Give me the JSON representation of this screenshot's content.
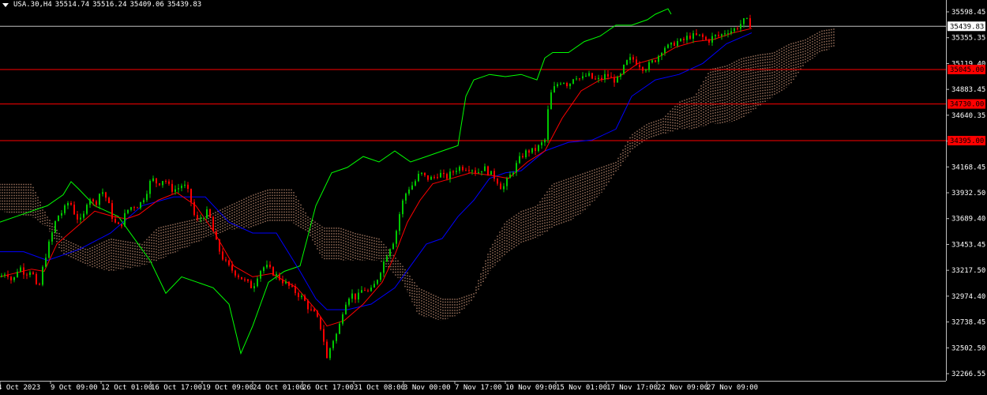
{
  "header": {
    "symbol": "USA.30,H4",
    "open": "35514.74",
    "high": "35516.24",
    "low": "35409.06",
    "close": "35439.83"
  },
  "chart_data": {
    "type": "candlestick",
    "background": "#000000",
    "colors": {
      "bull": "#00c800",
      "bear": "#ff0000",
      "tenkan": "#ff0000",
      "kijun": "#0000ff",
      "chikou": "#00ff00",
      "cloud": "#ffbd9a",
      "hline": "#ff0000",
      "current_price_line": "#c0c0c0",
      "axis": "#c0c0c0"
    },
    "ylim": [
      32200,
      35680
    ],
    "y_ticks": [
      "35598.45",
      "35355.35",
      "35119.40",
      "34883.45",
      "34640.35",
      "34404.40",
      "34168.45",
      "33932.50",
      "33689.40",
      "33453.45",
      "33217.50",
      "32974.40",
      "32738.45",
      "32502.50",
      "32266.55"
    ],
    "x_ticks": [
      "4 Oct 2023",
      "9 Oct 09:00",
      "12 Oct 01:00",
      "16 Oct 17:00",
      "19 Oct 09:00",
      "24 Oct 01:00",
      "26 Oct 17:00",
      "31 Oct 08:00",
      "3 Nov 00:00",
      "7 Nov 17:00",
      "10 Nov 09:00",
      "15 Nov 01:00",
      "17 Nov 17:00",
      "22 Nov 09:00",
      "27 Nov 09:00"
    ],
    "horizontal_levels": [
      {
        "label": "35045.00",
        "value": 35045.0
      },
      {
        "label": "34730.00",
        "value": 34730.0
      },
      {
        "label": "34395.00",
        "value": 34395.0
      }
    ],
    "current_price": {
      "label": "35439.83",
      "value": 35439.83
    },
    "close_path": [
      [
        0,
        33150
      ],
      [
        8,
        33200
      ],
      [
        16,
        33100
      ],
      [
        24,
        33250
      ],
      [
        32,
        33180
      ],
      [
        40,
        33220
      ],
      [
        48,
        33000
      ],
      [
        56,
        33300
      ],
      [
        64,
        33500
      ],
      [
        72,
        33700
      ],
      [
        80,
        33750
      ],
      [
        88,
        33850
      ],
      [
        96,
        33700
      ],
      [
        104,
        33650
      ],
      [
        112,
        33900
      ],
      [
        120,
        33800
      ],
      [
        128,
        33950
      ],
      [
        136,
        33850
      ],
      [
        144,
        33650
      ],
      [
        152,
        33600
      ],
      [
        160,
        33750
      ],
      [
        168,
        33800
      ],
      [
        176,
        33800
      ],
      [
        184,
        33900
      ],
      [
        192,
        34050
      ],
      [
        200,
        34000
      ],
      [
        208,
        34050
      ],
      [
        216,
        33950
      ],
      [
        224,
        33950
      ],
      [
        232,
        34000
      ],
      [
        240,
        33900
      ],
      [
        248,
        33650
      ],
      [
        256,
        33700
      ],
      [
        264,
        33750
      ],
      [
        272,
        33500
      ],
      [
        280,
        33350
      ],
      [
        288,
        33250
      ],
      [
        296,
        33200
      ],
      [
        304,
        33150
      ],
      [
        312,
        33100
      ],
      [
        320,
        33050
      ],
      [
        328,
        33200
      ],
      [
        336,
        33250
      ],
      [
        344,
        33200
      ],
      [
        352,
        33150
      ],
      [
        360,
        33100
      ],
      [
        368,
        33050
      ],
      [
        376,
        33000
      ],
      [
        384,
        32950
      ],
      [
        392,
        32850
      ],
      [
        400,
        32800
      ],
      [
        408,
        32650
      ],
      [
        414,
        32400
      ],
      [
        420,
        32550
      ],
      [
        428,
        32650
      ],
      [
        436,
        32900
      ],
      [
        444,
        33000
      ],
      [
        452,
        32950
      ],
      [
        460,
        33050
      ],
      [
        468,
        33000
      ],
      [
        476,
        33100
      ],
      [
        484,
        33250
      ],
      [
        492,
        33400
      ],
      [
        500,
        33500
      ],
      [
        508,
        33800
      ],
      [
        516,
        33950
      ],
      [
        524,
        34000
      ],
      [
        532,
        34100
      ],
      [
        540,
        34050
      ],
      [
        548,
        34050
      ],
      [
        556,
        34100
      ],
      [
        564,
        34050
      ],
      [
        572,
        34100
      ],
      [
        580,
        34150
      ],
      [
        588,
        34150
      ],
      [
        596,
        34150
      ],
      [
        604,
        34100
      ],
      [
        612,
        34150
      ],
      [
        620,
        34100
      ],
      [
        628,
        34050
      ],
      [
        636,
        33950
      ],
      [
        644,
        34050
      ],
      [
        652,
        34150
      ],
      [
        660,
        34250
      ],
      [
        668,
        34300
      ],
      [
        676,
        34300
      ],
      [
        684,
        34350
      ],
      [
        690,
        34400
      ],
      [
        696,
        34800
      ],
      [
        704,
        34900
      ],
      [
        712,
        34950
      ],
      [
        720,
        34900
      ],
      [
        728,
        35000
      ],
      [
        736,
        34950
      ],
      [
        744,
        35000
      ],
      [
        752,
        34950
      ],
      [
        760,
        34950
      ],
      [
        768,
        35000
      ],
      [
        776,
        34950
      ],
      [
        784,
        34950
      ],
      [
        792,
        35100
      ],
      [
        800,
        35150
      ],
      [
        808,
        35100
      ],
      [
        816,
        35050
      ],
      [
        824,
        35100
      ],
      [
        832,
        35150
      ],
      [
        840,
        35250
      ],
      [
        848,
        35250
      ],
      [
        856,
        35300
      ],
      [
        864,
        35300
      ],
      [
        872,
        35350
      ],
      [
        880,
        35350
      ],
      [
        888,
        35350
      ],
      [
        896,
        35300
      ],
      [
        904,
        35350
      ],
      [
        912,
        35350
      ],
      [
        920,
        35400
      ],
      [
        928,
        35400
      ],
      [
        936,
        35450
      ],
      [
        944,
        35500
      ],
      [
        952,
        35440
      ]
    ],
    "tenkan_path": [
      [
        0,
        33150
      ],
      [
        40,
        33220
      ],
      [
        56,
        33200
      ],
      [
        72,
        33450
      ],
      [
        96,
        33600
      ],
      [
        120,
        33750
      ],
      [
        144,
        33700
      ],
      [
        160,
        33680
      ],
      [
        176,
        33720
      ],
      [
        200,
        33850
      ],
      [
        224,
        33920
      ],
      [
        248,
        33800
      ],
      [
        272,
        33550
      ],
      [
        296,
        33250
      ],
      [
        320,
        33150
      ],
      [
        344,
        33180
      ],
      [
        376,
        33050
      ],
      [
        400,
        32850
      ],
      [
        414,
        32700
      ],
      [
        436,
        32750
      ],
      [
        460,
        32900
      ],
      [
        484,
        33100
      ],
      [
        500,
        33350
      ],
      [
        516,
        33650
      ],
      [
        532,
        33850
      ],
      [
        548,
        34000
      ],
      [
        572,
        34050
      ],
      [
        596,
        34100
      ],
      [
        620,
        34080
      ],
      [
        644,
        34050
      ],
      [
        668,
        34200
      ],
      [
        690,
        34300
      ],
      [
        712,
        34600
      ],
      [
        736,
        34850
      ],
      [
        760,
        34950
      ],
      [
        784,
        34980
      ],
      [
        808,
        35100
      ],
      [
        832,
        35150
      ],
      [
        856,
        35250
      ],
      [
        880,
        35300
      ],
      [
        904,
        35320
      ],
      [
        928,
        35380
      ],
      [
        952,
        35420
      ]
    ],
    "kijun_path": [
      [
        0,
        33380
      ],
      [
        30,
        33380
      ],
      [
        60,
        33300
      ],
      [
        100,
        33400
      ],
      [
        140,
        33550
      ],
      [
        180,
        33800
      ],
      [
        220,
        33880
      ],
      [
        260,
        33880
      ],
      [
        290,
        33650
      ],
      [
        320,
        33550
      ],
      [
        350,
        33550
      ],
      [
        380,
        33200
      ],
      [
        400,
        32950
      ],
      [
        414,
        32850
      ],
      [
        440,
        32850
      ],
      [
        470,
        32900
      ],
      [
        500,
        33050
      ],
      [
        520,
        33250
      ],
      [
        540,
        33450
      ],
      [
        560,
        33500
      ],
      [
        580,
        33700
      ],
      [
        600,
        33850
      ],
      [
        620,
        34050
      ],
      [
        640,
        34100
      ],
      [
        660,
        34120
      ],
      [
        690,
        34300
      ],
      [
        720,
        34380
      ],
      [
        750,
        34400
      ],
      [
        780,
        34500
      ],
      [
        800,
        34800
      ],
      [
        830,
        34950
      ],
      [
        860,
        35000
      ],
      [
        890,
        35100
      ],
      [
        920,
        35280
      ],
      [
        952,
        35380
      ]
    ],
    "chikou_path": [
      [
        0,
        33650
      ],
      [
        20,
        33700
      ],
      [
        40,
        33750
      ],
      [
        60,
        33800
      ],
      [
        80,
        33900
      ],
      [
        90,
        34020
      ],
      [
        100,
        33950
      ],
      [
        120,
        33800
      ],
      [
        150,
        33700
      ],
      [
        170,
        33500
      ],
      [
        190,
        33300
      ],
      [
        210,
        33000
      ],
      [
        230,
        33150
      ],
      [
        250,
        33100
      ],
      [
        270,
        33050
      ],
      [
        290,
        32900
      ],
      [
        305,
        32450
      ],
      [
        320,
        32700
      ],
      [
        340,
        33100
      ],
      [
        360,
        33200
      ],
      [
        380,
        33250
      ],
      [
        400,
        33800
      ],
      [
        410,
        33950
      ],
      [
        420,
        34100
      ],
      [
        440,
        34150
      ],
      [
        460,
        34250
      ],
      [
        480,
        34200
      ],
      [
        500,
        34300
      ],
      [
        520,
        34200
      ],
      [
        540,
        34250
      ],
      [
        560,
        34300
      ],
      [
        580,
        34350
      ],
      [
        590,
        34800
      ],
      [
        600,
        34950
      ],
      [
        620,
        35000
      ],
      [
        640,
        34980
      ],
      [
        660,
        35000
      ],
      [
        680,
        34950
      ],
      [
        690,
        35150
      ],
      [
        700,
        35200
      ],
      [
        720,
        35200
      ],
      [
        740,
        35300
      ],
      [
        760,
        35350
      ],
      [
        780,
        35450
      ],
      [
        800,
        35450
      ],
      [
        820,
        35500
      ],
      [
        830,
        35550
      ],
      [
        846,
        35600
      ],
      [
        850,
        35550
      ]
    ],
    "cloud_a_path": [
      [
        0,
        34000
      ],
      [
        40,
        34000
      ],
      [
        60,
        33700
      ],
      [
        80,
        33500
      ],
      [
        110,
        33400
      ],
      [
        140,
        33500
      ],
      [
        180,
        33450
      ],
      [
        200,
        33600
      ],
      [
        230,
        33650
      ],
      [
        260,
        33700
      ],
      [
        290,
        33800
      ],
      [
        320,
        33900
      ],
      [
        340,
        33950
      ],
      [
        370,
        33950
      ],
      [
        390,
        33700
      ],
      [
        410,
        33600
      ],
      [
        430,
        33600
      ],
      [
        450,
        33550
      ],
      [
        480,
        33500
      ],
      [
        510,
        33250
      ],
      [
        530,
        33050
      ],
      [
        560,
        32950
      ],
      [
        580,
        32950
      ],
      [
        600,
        33000
      ],
      [
        620,
        33400
      ],
      [
        640,
        33650
      ],
      [
        660,
        33750
      ],
      [
        680,
        33800
      ],
      [
        700,
        34000
      ],
      [
        720,
        34050
      ],
      [
        740,
        34100
      ],
      [
        760,
        34150
      ],
      [
        780,
        34200
      ],
      [
        800,
        34450
      ],
      [
        820,
        34550
      ],
      [
        840,
        34600
      ],
      [
        860,
        34750
      ],
      [
        880,
        34800
      ],
      [
        900,
        35050
      ],
      [
        920,
        35080
      ],
      [
        940,
        35150
      ],
      [
        960,
        35180
      ],
      [
        980,
        35200
      ],
      [
        1000,
        35280
      ],
      [
        1020,
        35320
      ],
      [
        1040,
        35400
      ],
      [
        1057,
        35420
      ]
    ],
    "cloud_b_path": [
      [
        0,
        33750
      ],
      [
        40,
        33700
      ],
      [
        60,
        33600
      ],
      [
        80,
        33350
      ],
      [
        110,
        33250
      ],
      [
        140,
        33200
      ],
      [
        180,
        33250
      ],
      [
        200,
        33300
      ],
      [
        230,
        33400
      ],
      [
        260,
        33500
      ],
      [
        290,
        33580
      ],
      [
        320,
        33600
      ],
      [
        340,
        33650
      ],
      [
        370,
        33650
      ],
      [
        390,
        33550
      ],
      [
        410,
        33300
      ],
      [
        430,
        33300
      ],
      [
        450,
        33300
      ],
      [
        480,
        33300
      ],
      [
        510,
        33100
      ],
      [
        530,
        32800
      ],
      [
        560,
        32750
      ],
      [
        580,
        32800
      ],
      [
        600,
        32950
      ],
      [
        620,
        33200
      ],
      [
        640,
        33350
      ],
      [
        660,
        33450
      ],
      [
        680,
        33500
      ],
      [
        700,
        33600
      ],
      [
        720,
        33650
      ],
      [
        740,
        33750
      ],
      [
        760,
        33900
      ],
      [
        780,
        34100
      ],
      [
        800,
        34300
      ],
      [
        820,
        34400
      ],
      [
        840,
        34450
      ],
      [
        860,
        34500
      ],
      [
        880,
        34500
      ],
      [
        900,
        34550
      ],
      [
        920,
        34550
      ],
      [
        940,
        34600
      ],
      [
        960,
        34700
      ],
      [
        980,
        34800
      ],
      [
        1000,
        34900
      ],
      [
        1020,
        35100
      ],
      [
        1040,
        35200
      ],
      [
        1057,
        35250
      ]
    ]
  }
}
